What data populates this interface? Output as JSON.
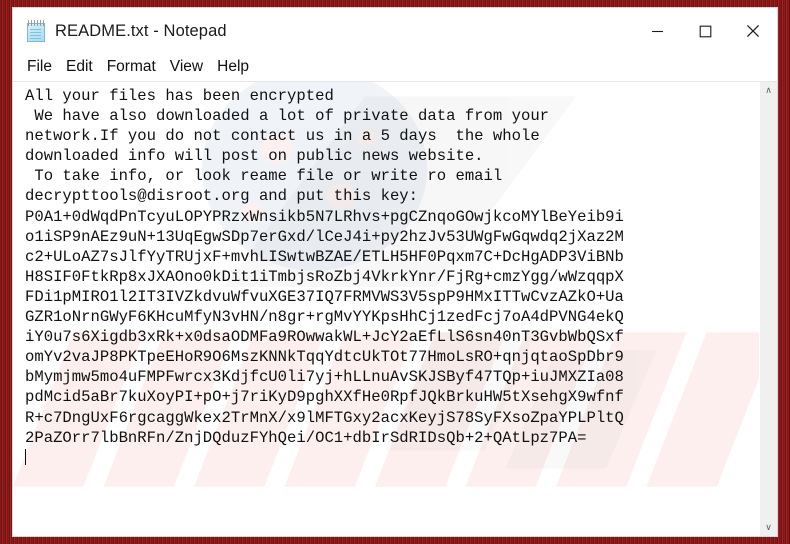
{
  "window": {
    "title": "README.txt - Notepad",
    "icon": "notepad-icon",
    "controls": {
      "minimize": "–",
      "maximize": "□",
      "close": "✕"
    }
  },
  "menu": {
    "items": [
      {
        "label": "File"
      },
      {
        "label": "Edit"
      },
      {
        "label": "Format"
      },
      {
        "label": "View"
      },
      {
        "label": "Help"
      }
    ]
  },
  "editor": {
    "message_lines": [
      "All your files has been encrypted",
      " We have also downloaded a lot of private data from your",
      "network.If you do not contact us in a 5 days  the whole",
      "downloaded info will post on public news website.",
      " To take info, or look reame file or write ro email",
      "decrypttools@disroot.org and put this key:"
    ],
    "contact_email": "decrypttools@disroot.org",
    "deadline_days": "5",
    "key_lines": [
      "P0A1+0dWqdPnTcyuLOPYPRzxWnsikb5N7LRhvs+pgCZnqoGOwjkcoMYlBeYeib9i",
      "o1iSP9nAEz9uN+13UqEgwSDp7erGxd/lCeJ4i+py2hzJv53UWgFwGqwdq2jXaz2M",
      "c2+ULoAZ7sJlfYyTRUjxF+mvhLISwtwBZAE/ETLH5HF0Pqxm7C+DcHgADP3ViBNb",
      "H8SIF0FtkRp8xJXAOno0kDit1iTmbjsRoZbj4VkrkYnr/FjRg+cmzYgg/wWzqqpX",
      "FDi1pMIRO1l2IT3IVZkdvuWfvuXGE37IQ7FRMVWS3V5spP9HMxITTwCvzAZkO+Ua",
      "GZR1oNrnGWyF6KHcuMfyN3vHN/n8gr+rgMvYYKpsHhCj1zedFcj7oA4dPVNG4ekQ",
      "iY0u7s6Xigdb3xRk+x0dsaODMFa9ROwwakWL+JcY2aEfLlS6sn40nT3GvbWbQSxf",
      "omYv2vaJP8PKTpeEHoR9O6MszKNNkTqqYdtcUkTOt77HmoLsRO+qnjqtaoSpDbr9",
      "bMymjmw5mo4uFMPFwrcx3KdjfcU0li7yj+hLLnuAvSKJSByf47TQp+iuJMXZIa08",
      "pdMcid5aBr7kuXoyPI+pO+j7riKyD9pghXXfHe0RpfJQkBrkuHW5tXsehgX9wfnf",
      "R+c7DngUxF6rgcaggWkex2TrMnX/x9lMFTGxy2acxKeyjS78SyFXsoZpaYPLPltQ",
      "2PaZOrr7lbBnRFn/ZnjDQduzFYhQei/OC1+dbIrSdRIDsQb+2+QAtLpz7PA="
    ],
    "full_text": "All your files has been encrypted\n We have also downloaded a lot of private data from your\nnetwork.If you do not contact us in a 5 days  the whole\ndownloaded info will post on public news website.\n To take info, or look reame file or write ro email\ndecrypttools@disroot.org and put this key:\nP0A1+0dWqdPnTcyuLOPYPRzxWnsikb5N7LRhvs+pgCZnqoGOwjkcoMYlBeYeib9i\no1iSP9nAEz9uN+13UqEgwSDp7erGxd/lCeJ4i+py2hzJv53UWgFwGqwdq2jXaz2M\nc2+ULoAZ7sJlfYyTRUjxF+mvhLISwtwBZAE/ETLH5HF0Pqxm7C+DcHgADP3ViBNb\nH8SIF0FtkRp8xJXAOno0kDit1iTmbjsRoZbj4VkrkYnr/FjRg+cmzYgg/wWzqqpX\nFDi1pMIRO1l2IT3IVZkdvuWfvuXGE37IQ7FRMVWS3V5spP9HMxITTwCvzAZkO+Ua\nGZR1oNrnGWyF6KHcuMfyN3vHN/n8gr+rgMvYYKpsHhCj1zedFcj7oA4dPVNG4ekQ\niY0u7s6Xigdb3xRk+x0dsaODMFa9ROwwakWL+JcY2aEfLlS6sn40nT3GvbWbQSxf\nomYv2vaJP8PKTpeEHoR9O6MszKNNkTqqYdtcUkTOt77HmoLsRO+qnjqtaoSpDbr9\nbMymjmw5mo4uFMPFwrcx3KdjfcU0li7yj+hLLnuAvSKJSByf47TQp+iuJMXZIa08\npdMcid5aBr7kuXoyPI+pO+j7riKyD9pghXXfHe0RpfJQkBrkuHW5tXsehgX9wfnf\nR+c7DngUxF6rgcaggWkex2TrMnX/x9lMFTGxy2acxKeyjS78SyFXsoZpaYPLPltQ\n2PaZOrr7lbBnRFn/ZnjDQduzFYhQei/OC1+dbIrSdRIDsQb+2+QAtLpz7PA="
  },
  "scrollbar": {
    "up_arrow": "∧",
    "down_arrow": "∨"
  },
  "colors": {
    "frame_red": "#7c1616",
    "window_bg": "#ffffff",
    "text": "#111111",
    "scrollbar_track": "#f0f0f0"
  }
}
